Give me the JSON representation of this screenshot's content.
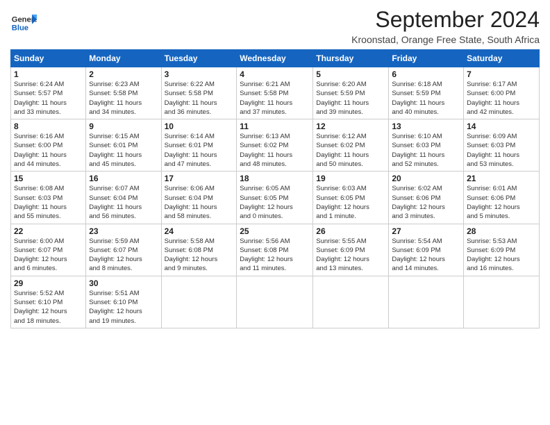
{
  "logo": {
    "general": "General",
    "blue": "Blue"
  },
  "header": {
    "month": "September 2024",
    "location": "Kroonstad, Orange Free State, South Africa"
  },
  "weekdays": [
    "Sunday",
    "Monday",
    "Tuesday",
    "Wednesday",
    "Thursday",
    "Friday",
    "Saturday"
  ],
  "weeks": [
    [
      {
        "day": "1",
        "info": "Sunrise: 6:24 AM\nSunset: 5:57 PM\nDaylight: 11 hours\nand 33 minutes."
      },
      {
        "day": "2",
        "info": "Sunrise: 6:23 AM\nSunset: 5:58 PM\nDaylight: 11 hours\nand 34 minutes."
      },
      {
        "day": "3",
        "info": "Sunrise: 6:22 AM\nSunset: 5:58 PM\nDaylight: 11 hours\nand 36 minutes."
      },
      {
        "day": "4",
        "info": "Sunrise: 6:21 AM\nSunset: 5:58 PM\nDaylight: 11 hours\nand 37 minutes."
      },
      {
        "day": "5",
        "info": "Sunrise: 6:20 AM\nSunset: 5:59 PM\nDaylight: 11 hours\nand 39 minutes."
      },
      {
        "day": "6",
        "info": "Sunrise: 6:18 AM\nSunset: 5:59 PM\nDaylight: 11 hours\nand 40 minutes."
      },
      {
        "day": "7",
        "info": "Sunrise: 6:17 AM\nSunset: 6:00 PM\nDaylight: 11 hours\nand 42 minutes."
      }
    ],
    [
      {
        "day": "8",
        "info": "Sunrise: 6:16 AM\nSunset: 6:00 PM\nDaylight: 11 hours\nand 44 minutes."
      },
      {
        "day": "9",
        "info": "Sunrise: 6:15 AM\nSunset: 6:01 PM\nDaylight: 11 hours\nand 45 minutes."
      },
      {
        "day": "10",
        "info": "Sunrise: 6:14 AM\nSunset: 6:01 PM\nDaylight: 11 hours\nand 47 minutes."
      },
      {
        "day": "11",
        "info": "Sunrise: 6:13 AM\nSunset: 6:02 PM\nDaylight: 11 hours\nand 48 minutes."
      },
      {
        "day": "12",
        "info": "Sunrise: 6:12 AM\nSunset: 6:02 PM\nDaylight: 11 hours\nand 50 minutes."
      },
      {
        "day": "13",
        "info": "Sunrise: 6:10 AM\nSunset: 6:03 PM\nDaylight: 11 hours\nand 52 minutes."
      },
      {
        "day": "14",
        "info": "Sunrise: 6:09 AM\nSunset: 6:03 PM\nDaylight: 11 hours\nand 53 minutes."
      }
    ],
    [
      {
        "day": "15",
        "info": "Sunrise: 6:08 AM\nSunset: 6:03 PM\nDaylight: 11 hours\nand 55 minutes."
      },
      {
        "day": "16",
        "info": "Sunrise: 6:07 AM\nSunset: 6:04 PM\nDaylight: 11 hours\nand 56 minutes."
      },
      {
        "day": "17",
        "info": "Sunrise: 6:06 AM\nSunset: 6:04 PM\nDaylight: 11 hours\nand 58 minutes."
      },
      {
        "day": "18",
        "info": "Sunrise: 6:05 AM\nSunset: 6:05 PM\nDaylight: 12 hours\nand 0 minutes."
      },
      {
        "day": "19",
        "info": "Sunrise: 6:03 AM\nSunset: 6:05 PM\nDaylight: 12 hours\nand 1 minute."
      },
      {
        "day": "20",
        "info": "Sunrise: 6:02 AM\nSunset: 6:06 PM\nDaylight: 12 hours\nand 3 minutes."
      },
      {
        "day": "21",
        "info": "Sunrise: 6:01 AM\nSunset: 6:06 PM\nDaylight: 12 hours\nand 5 minutes."
      }
    ],
    [
      {
        "day": "22",
        "info": "Sunrise: 6:00 AM\nSunset: 6:07 PM\nDaylight: 12 hours\nand 6 minutes."
      },
      {
        "day": "23",
        "info": "Sunrise: 5:59 AM\nSunset: 6:07 PM\nDaylight: 12 hours\nand 8 minutes."
      },
      {
        "day": "24",
        "info": "Sunrise: 5:58 AM\nSunset: 6:08 PM\nDaylight: 12 hours\nand 9 minutes."
      },
      {
        "day": "25",
        "info": "Sunrise: 5:56 AM\nSunset: 6:08 PM\nDaylight: 12 hours\nand 11 minutes."
      },
      {
        "day": "26",
        "info": "Sunrise: 5:55 AM\nSunset: 6:09 PM\nDaylight: 12 hours\nand 13 minutes."
      },
      {
        "day": "27",
        "info": "Sunrise: 5:54 AM\nSunset: 6:09 PM\nDaylight: 12 hours\nand 14 minutes."
      },
      {
        "day": "28",
        "info": "Sunrise: 5:53 AM\nSunset: 6:09 PM\nDaylight: 12 hours\nand 16 minutes."
      }
    ],
    [
      {
        "day": "29",
        "info": "Sunrise: 5:52 AM\nSunset: 6:10 PM\nDaylight: 12 hours\nand 18 minutes."
      },
      {
        "day": "30",
        "info": "Sunrise: 5:51 AM\nSunset: 6:10 PM\nDaylight: 12 hours\nand 19 minutes."
      },
      {
        "day": "",
        "info": ""
      },
      {
        "day": "",
        "info": ""
      },
      {
        "day": "",
        "info": ""
      },
      {
        "day": "",
        "info": ""
      },
      {
        "day": "",
        "info": ""
      }
    ]
  ]
}
